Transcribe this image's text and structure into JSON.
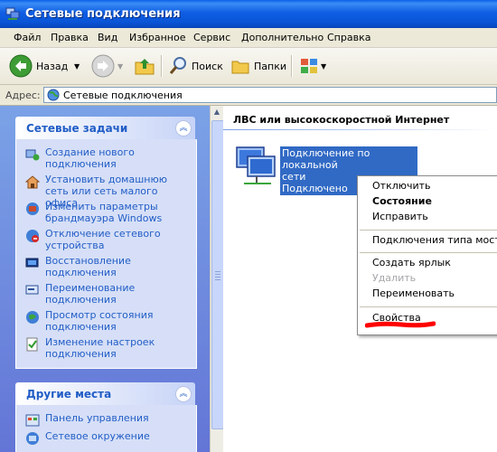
{
  "window": {
    "title": "Сетевые подключения"
  },
  "menubar": [
    "Файл",
    "Правка",
    "Вид",
    "Избранное",
    "Сервис",
    "Дополнительно",
    "Справка"
  ],
  "toolbar": {
    "back_label": "Назад",
    "search_label": "Поиск",
    "folders_label": "Папки"
  },
  "address": {
    "label": "Адрес:",
    "value": "Сетевые подключения"
  },
  "tasks_panel": {
    "title": "Сетевые задачи",
    "items": [
      {
        "label": "Создание нового подключения",
        "icon": "new-connection-icon"
      },
      {
        "label": "Установить домашнюю сеть или сеть малого офиса",
        "icon": "home-network-icon"
      },
      {
        "label": "Изменить параметры брандмауэра Windows",
        "icon": "firewall-icon"
      },
      {
        "label": "Отключение сетевого устройства",
        "icon": "disable-device-icon"
      },
      {
        "label": "Восстановление подключения",
        "icon": "repair-icon"
      },
      {
        "label": "Переименование подключения",
        "icon": "rename-icon"
      },
      {
        "label": "Просмотр состояния подключения",
        "icon": "status-icon"
      },
      {
        "label": "Изменение настроек подключения",
        "icon": "settings-icon"
      }
    ]
  },
  "places_panel": {
    "title": "Другие места",
    "items": [
      {
        "label": "Панель управления",
        "icon": "control-panel-icon"
      },
      {
        "label": "Сетевое окружение",
        "icon": "network-places-icon"
      }
    ]
  },
  "content": {
    "group_title": "ЛВС или высокоскоростной Интернет",
    "connection": {
      "line1": "Подключение по локальной",
      "line2": "сети",
      "line3": "Подключено"
    }
  },
  "context_menu": {
    "items": [
      "Отключить",
      "Состояние",
      "Исправить",
      "Подключения типа мост",
      "Создать ярлык",
      "Удалить",
      "Переименовать",
      "Свойства"
    ]
  },
  "colors": {
    "titlebar": "#0954d6",
    "task_link": "#215dc6",
    "selection": "#316ac5",
    "annotation": "#ff0000"
  }
}
